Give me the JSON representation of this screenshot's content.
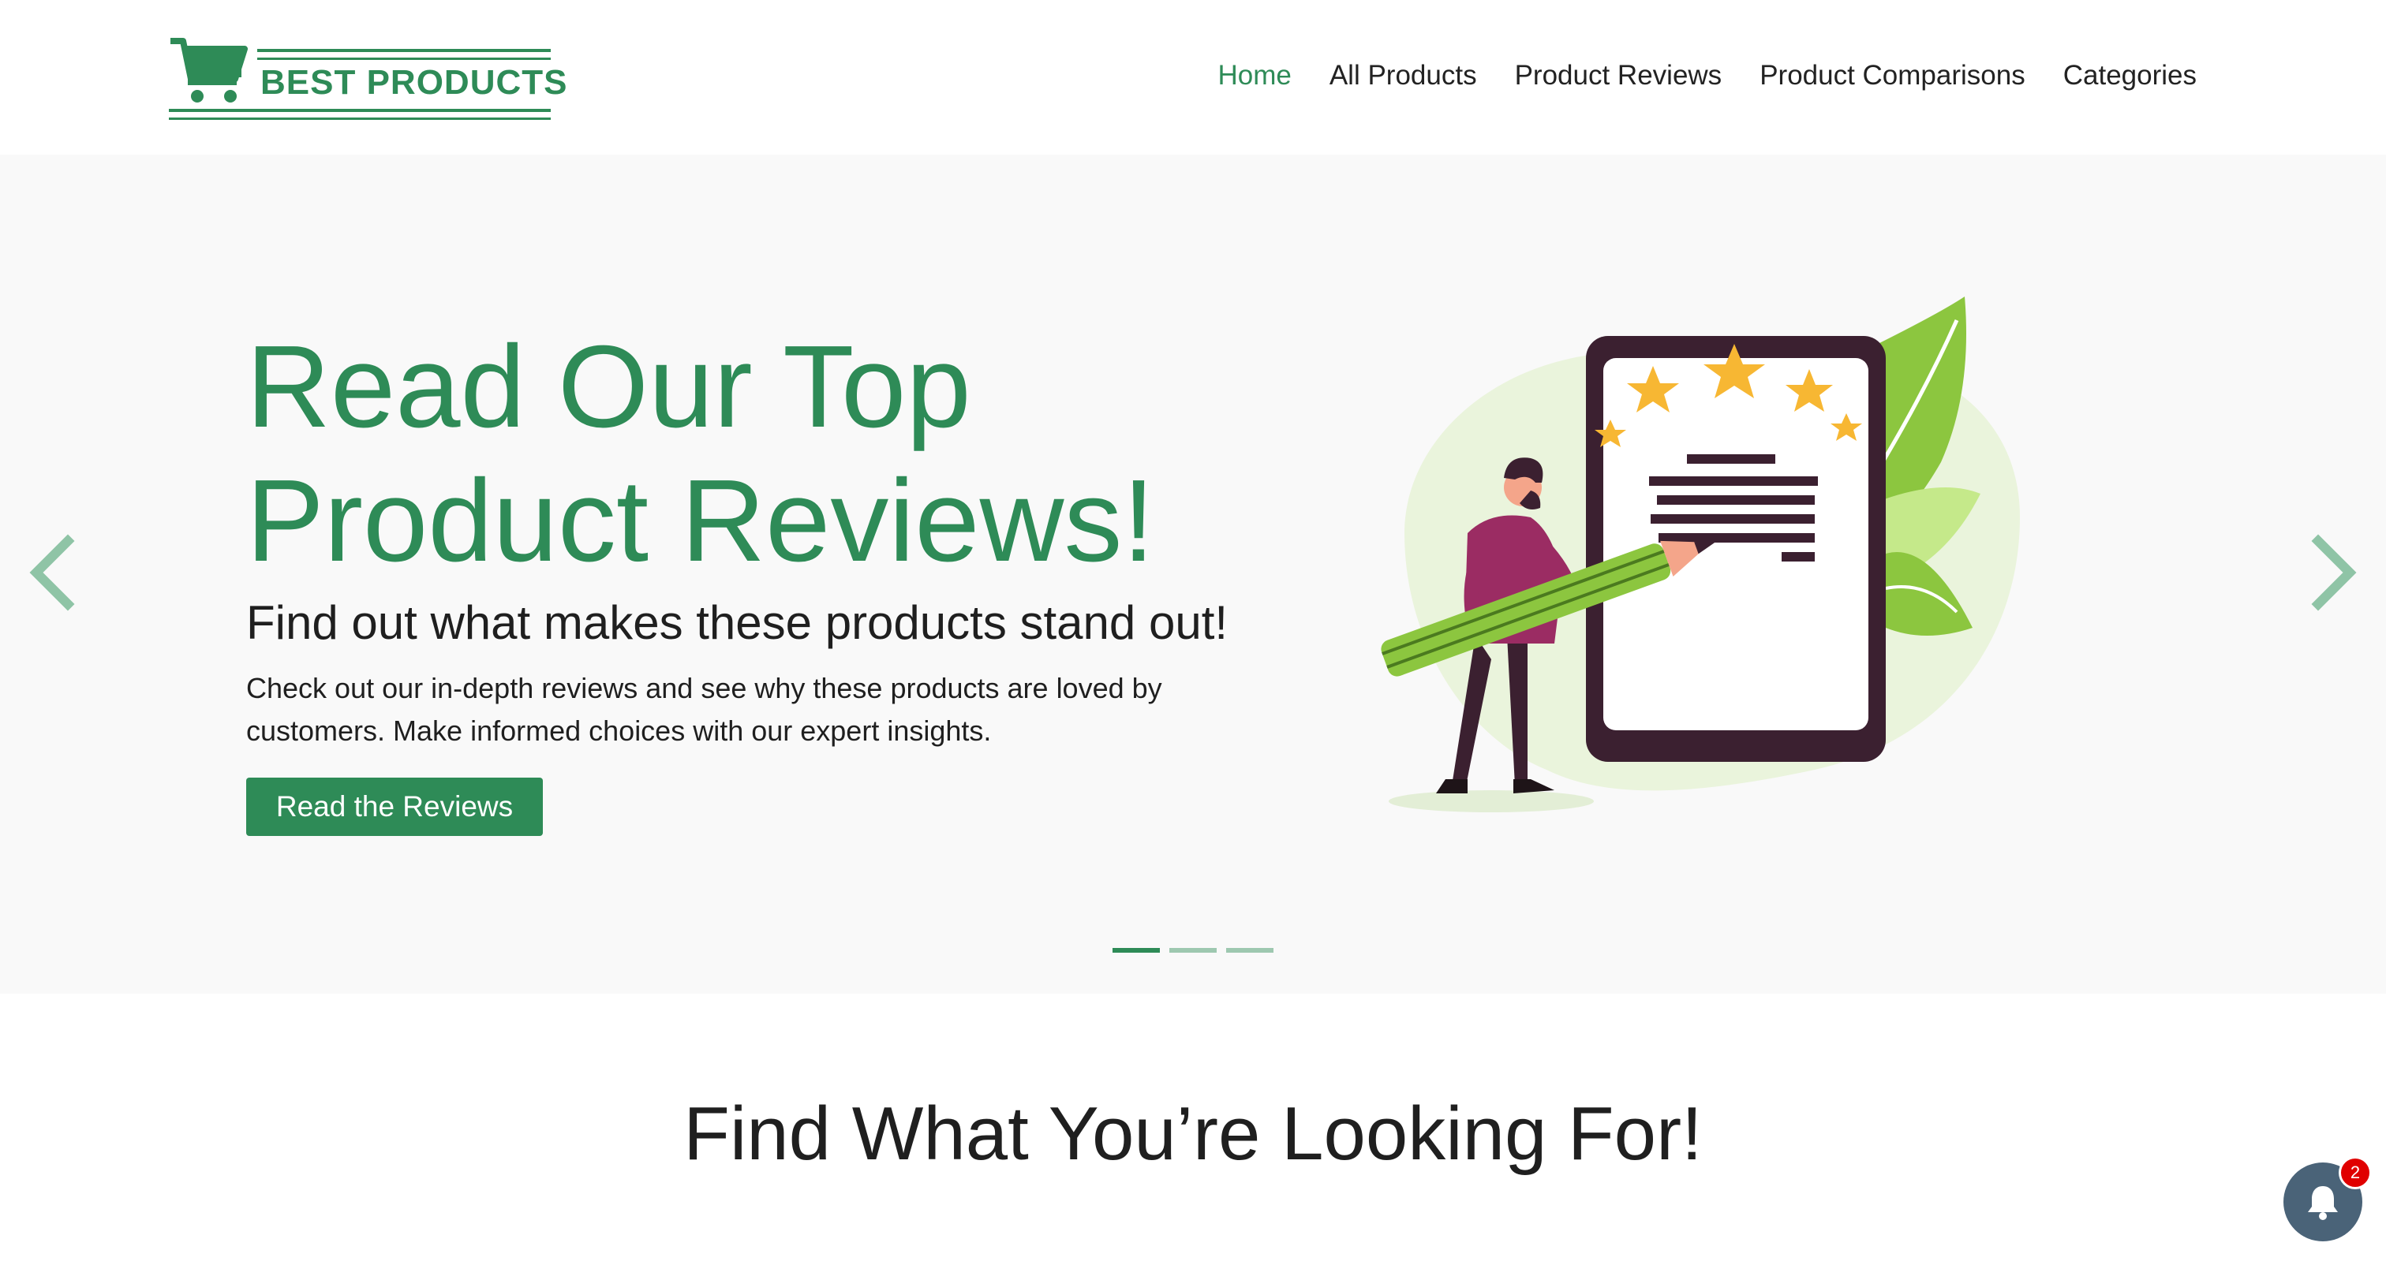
{
  "header": {
    "logo_text": "BEST PRODUCTS",
    "nav": [
      {
        "label": "Home",
        "active": true
      },
      {
        "label": "All Products",
        "active": false
      },
      {
        "label": "Product Reviews",
        "active": false
      },
      {
        "label": "Product Comparisons",
        "active": false
      },
      {
        "label": "Categories",
        "active": false
      }
    ]
  },
  "hero": {
    "title_line1": "Read Our Top",
    "title_line2": "Product Reviews!",
    "subtitle": "Find out what makes these products stand out!",
    "description": "Check out our in-depth reviews and see why these products are loved by customers. Make informed choices with our expert insights.",
    "button_label": "Read the Reviews",
    "slide_count": 3,
    "active_slide": 1
  },
  "section": {
    "title": "Find What You’re Looking For!"
  },
  "notifications": {
    "badge_count": "2"
  },
  "colors": {
    "brand_green": "#2e8b57",
    "hero_background": "#f9f9f9",
    "fab_background": "#4a6378",
    "badge_red": "#e00000"
  },
  "icons": {
    "logo": "shopping-cart-icon",
    "carousel_prev": "chevron-left-icon",
    "carousel_next": "chevron-right-icon",
    "notifications": "bell-icon"
  }
}
